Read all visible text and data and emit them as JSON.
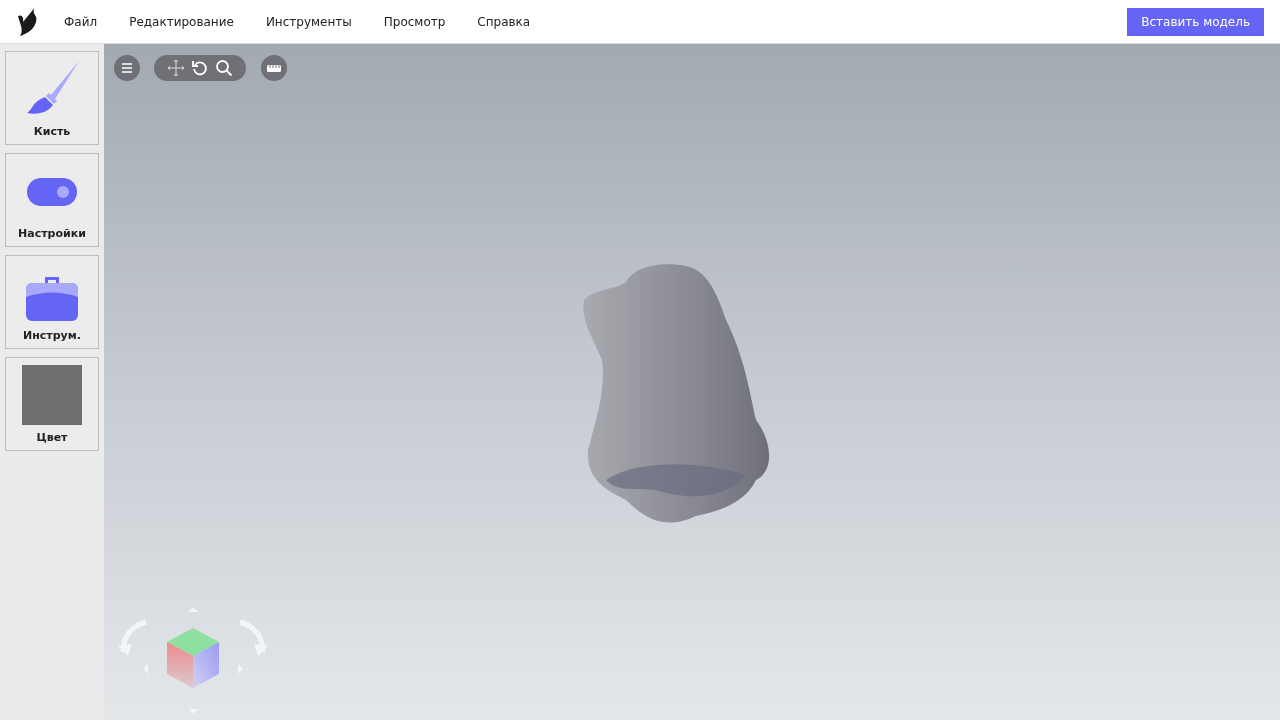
{
  "menu": [
    "Файл",
    "Редактирование",
    "Инструменты",
    "Просмотр",
    "Справка"
  ],
  "insert_button": "Вставить модель",
  "tools": [
    {
      "kind": "brush",
      "label": "Кисть"
    },
    {
      "kind": "toggle",
      "label": "Настройки"
    },
    {
      "kind": "case",
      "label": "Инструм."
    },
    {
      "kind": "swatch",
      "label": "Цвет",
      "color": "#6e6e6e"
    }
  ]
}
